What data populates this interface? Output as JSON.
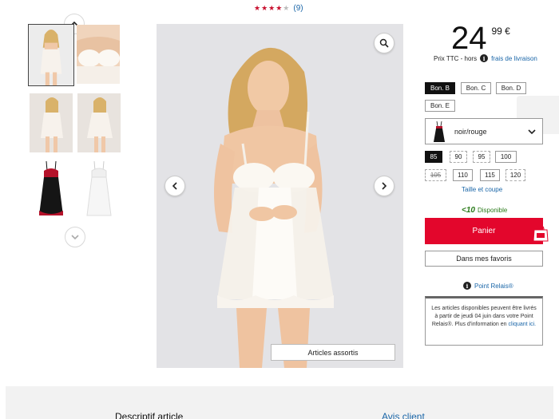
{
  "rating": {
    "stars": 4,
    "max": 5,
    "count": "(9)"
  },
  "gallery": {
    "thumbnails": [
      {
        "name": "thumb-front-white"
      },
      {
        "name": "thumb-closeup-white"
      },
      {
        "name": "thumb-pose-a"
      },
      {
        "name": "thumb-pose-b"
      },
      {
        "name": "thumb-black-red"
      },
      {
        "name": "thumb-white-flat"
      }
    ],
    "assorted_label": "Articles assortis"
  },
  "price": {
    "integer": "24",
    "decimal": "99 €",
    "tax_label": "Prix TTC - hors",
    "shipping_link": "frais de livraison"
  },
  "cups": [
    {
      "label": "Bon. B",
      "selected": true
    },
    {
      "label": "Bon. C",
      "selected": false
    },
    {
      "label": "Bon. D",
      "selected": false
    },
    {
      "label": "Bon. E",
      "selected": false
    }
  ],
  "color": {
    "label": "noir/rouge"
  },
  "sizes": [
    {
      "label": "85",
      "state": "selected"
    },
    {
      "label": "90",
      "state": "limited"
    },
    {
      "label": "95",
      "state": "limited"
    },
    {
      "label": "100",
      "state": "available"
    },
    {
      "label": "105",
      "state": "unavailable"
    },
    {
      "label": "110",
      "state": "available"
    },
    {
      "label": "115",
      "state": "available"
    },
    {
      "label": "120",
      "state": "limited"
    }
  ],
  "size_guide": "Taille et coupe",
  "availability": {
    "code": "<10",
    "label": "Disponible"
  },
  "cart_button": "Panier",
  "favorites_button": "Dans mes favoris",
  "relais": {
    "title": "Point Relais®",
    "text": "Les articles disponibles peuvent être livrés à partir de jeudi 04 juin dans votre Point Relais®. Plus d'information en",
    "link": "cliquant ici."
  },
  "footer_tabs": {
    "description": "Descriptif article",
    "reviews": "Avis client"
  },
  "colors": {
    "accent_red": "#e3062c",
    "link_blue": "#1a66a8",
    "available_green": "#2a7a1a"
  }
}
